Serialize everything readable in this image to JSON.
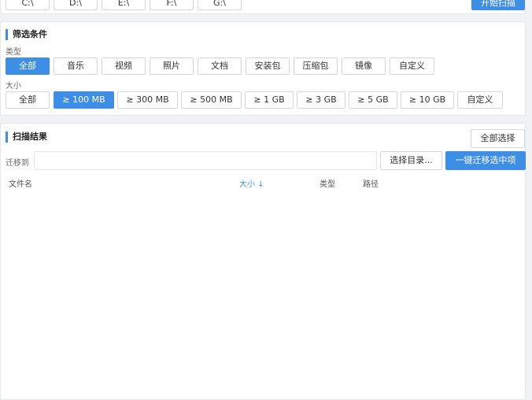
{
  "drives": {
    "items": [
      "C:\\",
      "D:\\",
      "E:\\",
      "F:\\",
      "G:\\"
    ],
    "scan_label": "开始扫描"
  },
  "filter": {
    "title": "筛选条件",
    "type_label": "类型",
    "types": [
      "全部",
      "音乐",
      "视频",
      "照片",
      "文档",
      "安装包",
      "压缩包",
      "镜像",
      "自定义"
    ],
    "selected_type": "全部",
    "size_label": "大小",
    "sizes": [
      "全部",
      "≥ 100 MB",
      "≥ 300 MB",
      "≥ 500 MB",
      "≥ 1 GB",
      "≥ 3 GB",
      "≥ 5 GB",
      "≥ 10 GB",
      "自定义"
    ],
    "selected_size": "≥ 100 MB"
  },
  "results": {
    "title": "扫描结果",
    "select_all_label": "全部选择",
    "migrate_label": "迁移到",
    "migrate_path": "",
    "choose_dir_label": "选择目录...",
    "migrate_button_label": "一键迁移选中项",
    "columns": {
      "name": "文件名",
      "size": "大小 ↓",
      "type": "类型",
      "path": "路径"
    },
    "rows": []
  },
  "colors": {
    "accent": "#3f8ee6",
    "background": "#f0f2f5",
    "panel": "#ffffff"
  }
}
